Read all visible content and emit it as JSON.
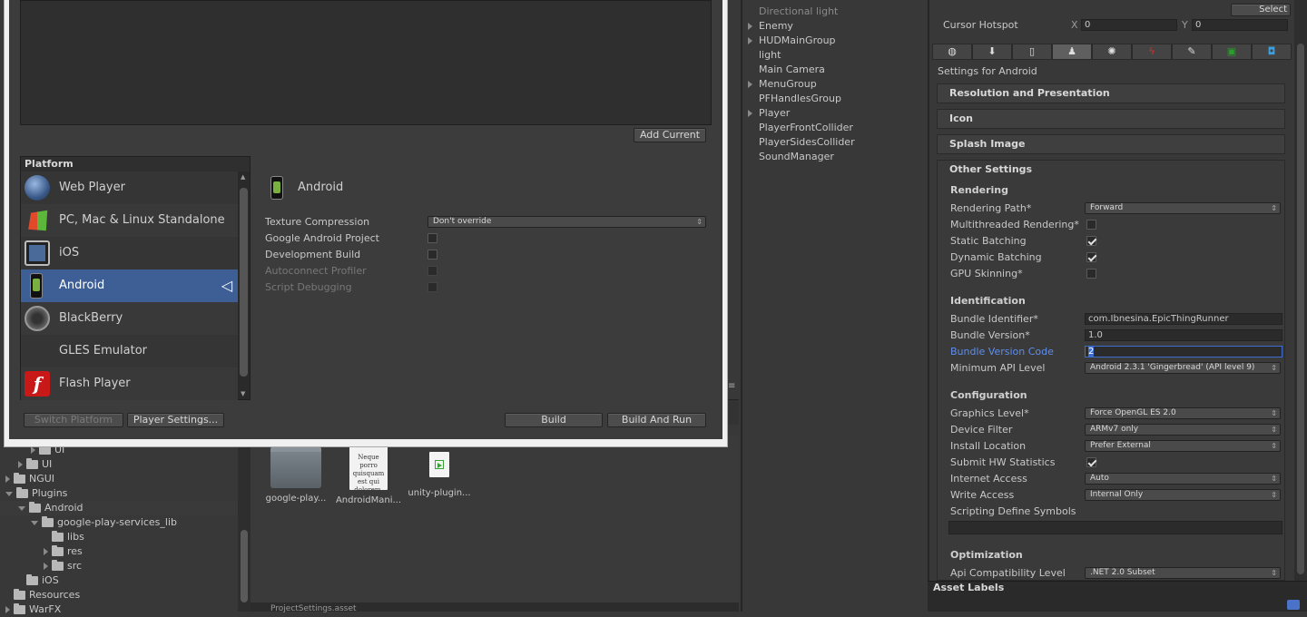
{
  "dialog": {
    "add_current_label": "Add Current",
    "platform_header": "Platform",
    "platforms": [
      {
        "label": "Web Player",
        "icon": "globe-icon"
      },
      {
        "label": "PC, Mac & Linux Standalone",
        "icon": "windows-icon"
      },
      {
        "label": "iOS",
        "icon": "ipad-icon"
      },
      {
        "label": "Android",
        "icon": "android-phone-icon",
        "selected": true
      },
      {
        "label": "BlackBerry",
        "icon": "blackberry-icon"
      },
      {
        "label": "GLES Emulator",
        "icon": ""
      },
      {
        "label": "Flash Player",
        "icon": "flash-icon"
      }
    ],
    "selected_platform_title": "Android",
    "texture_compression_label": "Texture Compression",
    "texture_compression_value": "Don't override",
    "google_android_project_label": "Google Android Project",
    "development_build_label": "Development Build",
    "autoconnect_profiler_label": "Autoconnect Profiler",
    "script_debugging_label": "Script Debugging",
    "switch_platform_label": "Switch Platform",
    "player_settings_label": "Player Settings...",
    "build_label": "Build",
    "build_and_run_label": "Build And Run"
  },
  "project": {
    "tree": [
      {
        "label": "UI",
        "indent": 3,
        "expand": "right"
      },
      {
        "label": "UI",
        "indent": 2,
        "expand": "right"
      },
      {
        "label": "NGUI",
        "indent": 1,
        "expand": "right"
      },
      {
        "label": "Plugins",
        "indent": 1,
        "expand": "down"
      },
      {
        "label": "Android",
        "indent": 2,
        "expand": "down",
        "selected": true
      },
      {
        "label": "google-play-services_lib",
        "indent": 3,
        "expand": "down"
      },
      {
        "label": "libs",
        "indent": 4,
        "expand": "none"
      },
      {
        "label": "res",
        "indent": 4,
        "expand": "right"
      },
      {
        "label": "src",
        "indent": 4,
        "expand": "right"
      },
      {
        "label": "iOS",
        "indent": 2,
        "expand": "none"
      },
      {
        "label": "Resources",
        "indent": 1,
        "expand": "none"
      },
      {
        "label": "WarFX",
        "indent": 1,
        "expand": "right"
      }
    ],
    "assets": [
      {
        "label": "google-play...",
        "kind": "folder"
      },
      {
        "label": "AndroidMani...",
        "kind": "document",
        "preview_text": "Neque porro quisquam est qui dolorem."
      },
      {
        "label": "unity-plugin...",
        "kind": "script"
      }
    ],
    "bottom_label": "ProjectSettings.asset"
  },
  "hierarchy": {
    "items": [
      {
        "label": "Directional light",
        "expand": false,
        "dim": true
      },
      {
        "label": "Enemy",
        "expand": true
      },
      {
        "label": "HUDMainGroup",
        "expand": true
      },
      {
        "label": "light",
        "expand": false
      },
      {
        "label": "Main Camera",
        "expand": false
      },
      {
        "label": "MenuGroup",
        "expand": true
      },
      {
        "label": "PFHandlesGroup",
        "expand": false
      },
      {
        "label": "Player",
        "expand": true
      },
      {
        "label": "PlayerFrontCollider",
        "expand": false
      },
      {
        "label": "PlayerSidesCollider",
        "expand": false
      },
      {
        "label": "SoundManager",
        "expand": false
      }
    ]
  },
  "inspector": {
    "select_label": "Select",
    "cursor_hotspot_label": "Cursor Hotspot",
    "hotspot_x_label": "X",
    "hotspot_x": "0",
    "hotspot_y_label": "Y",
    "hotspot_y": "0",
    "platform_tabs": [
      "globe-icon",
      "download-icon",
      "phone-icon",
      "android-icon",
      "blackberry-icon",
      "flash-icon",
      "wrench-icon",
      "xbox-icon",
      "windows-store-icon"
    ],
    "settings_for": "Settings for Android",
    "sections": [
      "Resolution and Presentation",
      "Icon",
      "Splash Image",
      "Other Settings"
    ],
    "rendering": {
      "header": "Rendering",
      "rendering_path_label": "Rendering Path*",
      "rendering_path": "Forward",
      "multithreaded_label": "Multithreaded Rendering*",
      "static_batching_label": "Static Batching",
      "dynamic_batching_label": "Dynamic Batching",
      "gpu_skinning_label": "GPU Skinning*"
    },
    "identification": {
      "header": "Identification",
      "bundle_id_label": "Bundle Identifier*",
      "bundle_id": "com.Ibnesina.EpicThingRunner",
      "bundle_version_label": "Bundle Version*",
      "bundle_version": "1.0",
      "bundle_version_code_label": "Bundle Version Code",
      "bundle_version_code": "2",
      "min_api_label": "Minimum API Level",
      "min_api": "Android 2.3.1 'Gingerbread' (API level 9)"
    },
    "configuration": {
      "header": "Configuration",
      "graphics_level_label": "Graphics Level*",
      "graphics_level": "Force OpenGL ES 2.0",
      "device_filter_label": "Device Filter",
      "device_filter": "ARMv7 only",
      "install_location_label": "Install Location",
      "install_location": "Prefer External",
      "submit_hw_label": "Submit HW Statistics",
      "internet_access_label": "Internet Access",
      "internet_access": "Auto",
      "write_access_label": "Write Access",
      "write_access": "Internal Only",
      "scripting_define_label": "Scripting Define Symbols"
    },
    "optimization": {
      "header": "Optimization",
      "api_compat_label": "Api Compatibility Level",
      "api_compat": ".NET 2.0 Subset"
    },
    "asset_labels": "Asset Labels"
  },
  "colors": {
    "selection_blue": "#3e5f96",
    "focus_blue": "#3d6ecf",
    "label_blue": "#5d8ef0",
    "panel_bg": "#383838"
  }
}
